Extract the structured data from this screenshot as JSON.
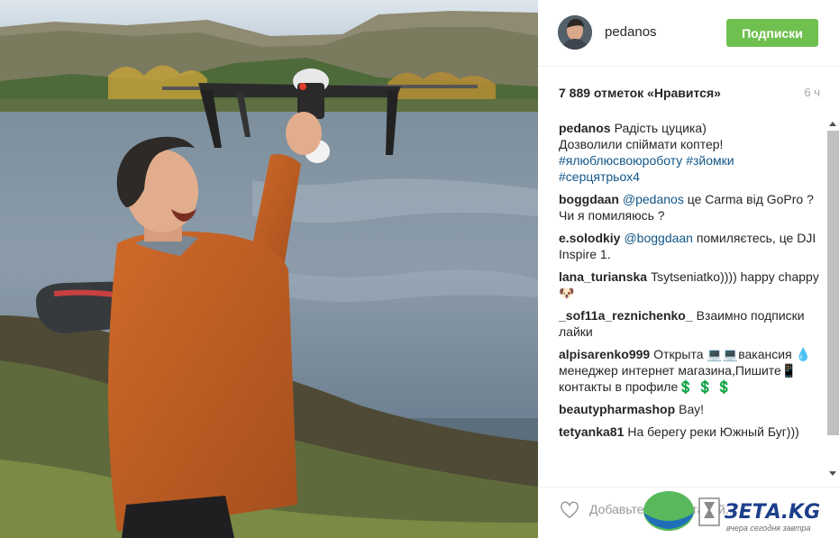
{
  "post": {
    "author": "pedanos",
    "follow_label": "Подписки",
    "likes": "7 889 отметок «Нравится»",
    "time": "6 ч"
  },
  "caption": {
    "author": "pedanos",
    "text_parts": [
      "Радість цуцика)",
      "Дозволили спіймати коптер!"
    ],
    "hashtags": [
      "#ялюблюсвоюроботу",
      "#зйомки",
      "#серцятрьох4"
    ]
  },
  "comments": [
    {
      "author": "boggdaan",
      "mention": "@pedanos",
      "text": "це Carma від GoPro ? Чи я помиляюсь ?"
    },
    {
      "author": "e.solodkiy",
      "mention": "@boggdaan",
      "text": "помиляєтесь, це DJI Inspire 1."
    },
    {
      "author": "lana_turianska",
      "mention": "",
      "text": "Tsytseniatko)))) happy chappy 🐶"
    },
    {
      "author": "_sof11a_reznichenko_",
      "mention": "",
      "text": "Взаимно подписки лайки"
    },
    {
      "author": "alpisarenko999",
      "mention": "",
      "text": "Открыта 💻💻вакансия 💧менеджер интернет магазина,Пишите📱 контакты в профиле💲 💲 💲"
    },
    {
      "author": "beautypharmashop",
      "mention": "",
      "text": "Вау!"
    },
    {
      "author": "tetyanka81",
      "mention": "",
      "text": "На берегу реки Южный Буг)))"
    }
  ],
  "footer": {
    "comment_placeholder": "Добавьте комментарий..."
  },
  "watermark": {
    "brand": "ЗЕТА.KG",
    "tagline": "вчера сегодня завтра"
  },
  "colors": {
    "follow_green": "#70c050",
    "link_blue": "#125688",
    "watermark_blue": "#1d3f8a"
  }
}
